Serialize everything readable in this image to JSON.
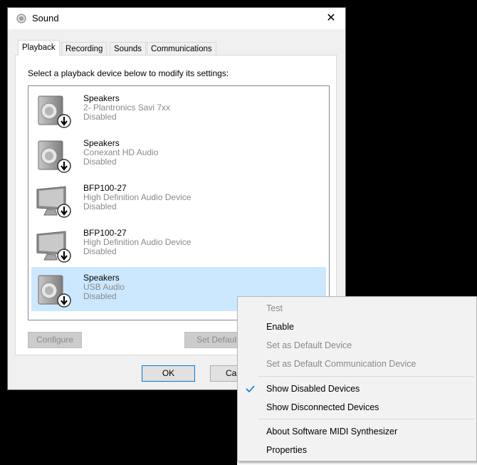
{
  "window": {
    "title": "Sound",
    "close_label": "✕"
  },
  "tabs": [
    {
      "label": "Playback",
      "active": true
    },
    {
      "label": "Recording",
      "active": false
    },
    {
      "label": "Sounds",
      "active": false
    },
    {
      "label": "Communications",
      "active": false
    }
  ],
  "instruction": "Select a playback device below to modify its settings:",
  "devices": [
    {
      "name": "Speakers",
      "subtitle": "2- Plantronics Savi 7xx",
      "status": "Disabled",
      "icon": "speaker-icon",
      "selected": false
    },
    {
      "name": "Speakers",
      "subtitle": "Conexant HD Audio",
      "status": "Disabled",
      "icon": "speaker-icon",
      "selected": false
    },
    {
      "name": "BFP100-27",
      "subtitle": "High Definition Audio Device",
      "status": "Disabled",
      "icon": "monitor-icon",
      "selected": false
    },
    {
      "name": "BFP100-27",
      "subtitle": "High Definition Audio Device",
      "status": "Disabled",
      "icon": "monitor-icon",
      "selected": false
    },
    {
      "name": "Speakers",
      "subtitle": "USB Audio",
      "status": "Disabled",
      "icon": "speaker-icon",
      "selected": true
    }
  ],
  "buttons": {
    "configure": "Configure",
    "set_default": "Set Defaul",
    "ok": "OK",
    "cancel": "Ca"
  },
  "context_menu": {
    "items": [
      {
        "label": "Test",
        "disabled": true,
        "checked": false
      },
      {
        "label": "Enable",
        "disabled": false,
        "checked": false
      },
      {
        "label": "Set as Default Device",
        "disabled": true,
        "checked": false
      },
      {
        "label": "Set as Default Communication Device",
        "disabled": true,
        "checked": false
      },
      {
        "label": "Show Disabled Devices",
        "disabled": false,
        "checked": true
      },
      {
        "label": "Show Disconnected Devices",
        "disabled": false,
        "checked": false
      },
      {
        "label": "About Software MIDI Synthesizer",
        "disabled": false,
        "checked": false
      },
      {
        "label": "Properties",
        "disabled": false,
        "checked": false
      }
    ]
  },
  "colors": {
    "selection": "#cce8ff",
    "accent": "#0078d7",
    "disabled_text": "#8a8a8a"
  }
}
